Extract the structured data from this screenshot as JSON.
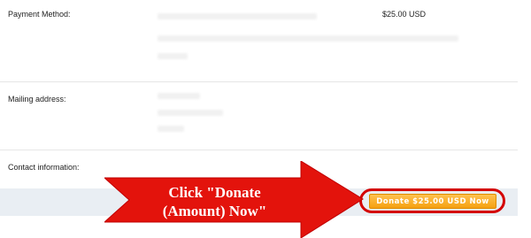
{
  "payment": {
    "label": "Payment Method:",
    "amount": "$25.00 USD"
  },
  "mailing": {
    "label": "Mailing address:"
  },
  "contact": {
    "label": "Contact information:"
  },
  "donate_button": {
    "label": "Donate $25.00 USD Now"
  },
  "callout": {
    "line1": "Click \"Donate",
    "line2": "(Amount) Now\"",
    "color": "#e3130c"
  }
}
